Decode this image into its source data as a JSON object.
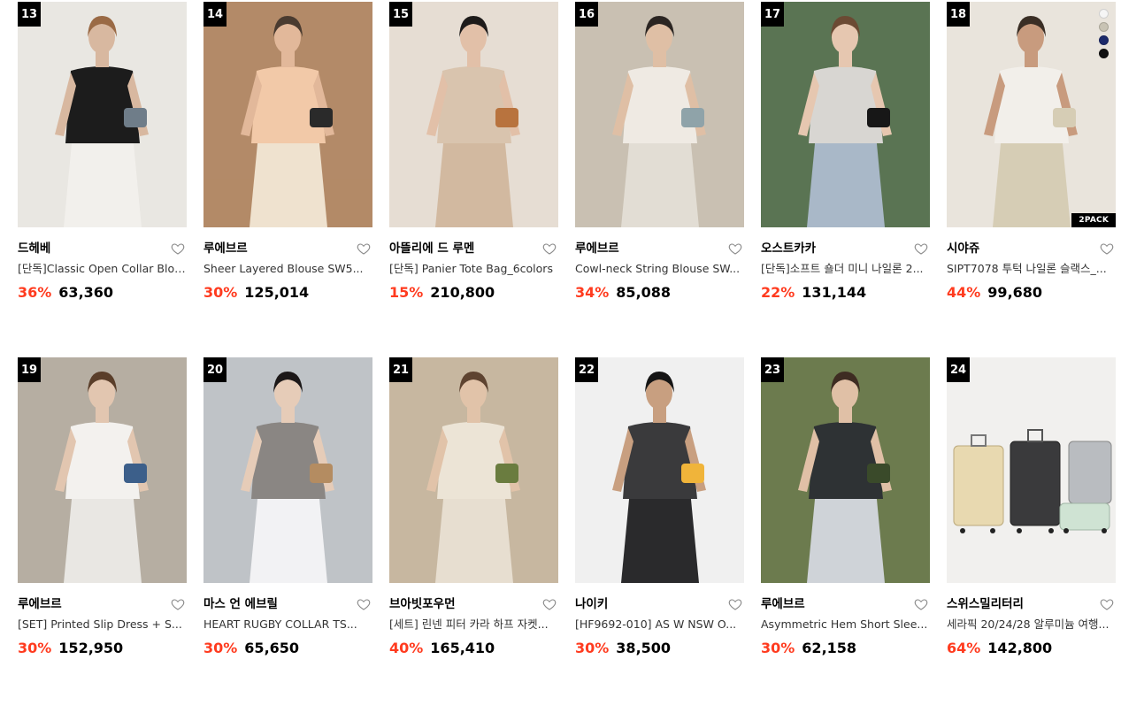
{
  "products": [
    {
      "rank": "13",
      "brand": "드헤베",
      "name": "[단독]Classic Open Collar Blouse",
      "discount": "36%",
      "price": "63,360",
      "colors": {
        "bg": "#e9e7e2",
        "top": "#1c1c1c",
        "bottom": "#f2f0ec",
        "skin": "#d8b8a0",
        "hair": "#9a6a45",
        "accent": "#6f7d89"
      }
    },
    {
      "rank": "14",
      "brand": "루에브르",
      "name": "Sheer Layered Blouse SW5...",
      "discount": "30%",
      "price": "125,014",
      "colors": {
        "bg": "#b38a68",
        "top": "#f2c9a8",
        "bottom": "#efe2cf",
        "skin": "#e2b89a",
        "hair": "#4a3b30",
        "accent": "#2a2a2a"
      }
    },
    {
      "rank": "15",
      "brand": "아뜰리에 드 루멘",
      "name": "[단독] Panier Tote Bag_6colors",
      "discount": "15%",
      "price": "210,800",
      "colors": {
        "bg": "#e6ddd3",
        "top": "#d9c4ae",
        "bottom": "#d2b9a0",
        "skin": "#e2c0a8",
        "hair": "#1e1b1a",
        "accent": "#b8733e"
      }
    },
    {
      "rank": "16",
      "brand": "루에브르",
      "name": "Cowl-neck String Blouse SW...",
      "discount": "34%",
      "price": "85,088",
      "colors": {
        "bg": "#c9c0b2",
        "top": "#efeae3",
        "bottom": "#e2ddd4",
        "skin": "#dfbfa5",
        "hair": "#2b2522",
        "accent": "#8fa3a9"
      }
    },
    {
      "rank": "17",
      "brand": "오스트카카",
      "name": "[단독]소프트 숄더 미니 나일론 2...",
      "discount": "22%",
      "price": "131,144",
      "colors": {
        "bg": "#5a7453",
        "top": "#d8d6d2",
        "bottom": "#a9b8c8",
        "skin": "#e6c7b0",
        "hair": "#6b4a33",
        "accent": "#171717"
      }
    },
    {
      "rank": "18",
      "brand": "시야쥬",
      "name": "SIPT7078 투턱 나일론 슬랙스_...",
      "discount": "44%",
      "price": "99,680",
      "colors": {
        "bg": "#e9e4dc",
        "top": "#f2efea",
        "bottom": "#d6cdb5",
        "skin": "#c89b7e",
        "hair": "#3a2e25",
        "accent": "#d6cdb5"
      },
      "swatches": [
        "#f5f5f5",
        "#c8c3b4",
        "#1c2a6b",
        "#111111"
      ],
      "badge": "2PACK"
    },
    {
      "rank": "19",
      "brand": "루에브르",
      "name": "[SET] Printed Slip Dress + S...",
      "discount": "30%",
      "price": "152,950",
      "colors": {
        "bg": "#b6aea2",
        "top": "#f3f1ee",
        "bottom": "#e9e7e3",
        "skin": "#e2c6b0",
        "hair": "#5a3e2a",
        "accent": "#3c5f8a"
      }
    },
    {
      "rank": "20",
      "brand": "마스 언 에브릴",
      "name": "HEART RUGBY COLLAR TS...",
      "discount": "30%",
      "price": "65,650",
      "colors": {
        "bg": "#bfc3c7",
        "top": "#8a8683",
        "bottom": "#f2f2f4",
        "skin": "#e6ccb8",
        "hair": "#1c1818",
        "accent": "#b48c61"
      }
    },
    {
      "rank": "21",
      "brand": "브아빗포우먼",
      "name": "[세트] 린넨 피터 카라 하프 자켓...",
      "discount": "40%",
      "price": "165,410",
      "colors": {
        "bg": "#c7b7a0",
        "top": "#ece4d6",
        "bottom": "#e7ded0",
        "skin": "#e1c3a9",
        "hair": "#5e4330",
        "accent": "#6a7c3f"
      }
    },
    {
      "rank": "22",
      "brand": "나이키",
      "name": "[HF9692-010] AS W NSW O...",
      "discount": "30%",
      "price": "38,500",
      "colors": {
        "bg": "#f0f0f0",
        "top": "#3a3a3c",
        "bottom": "#2a2a2c",
        "skin": "#c89f80",
        "hair": "#151515",
        "accent": "#f0b43a"
      }
    },
    {
      "rank": "23",
      "brand": "루에브르",
      "name": "Asymmetric Hem Short Slee...",
      "discount": "30%",
      "price": "62,158",
      "colors": {
        "bg": "#6c7b4e",
        "top": "#2e3234",
        "bottom": "#cfd3d8",
        "skin": "#e0c0a6",
        "hair": "#3e2c22",
        "accent": "#3a4a2a"
      }
    },
    {
      "rank": "24",
      "brand": "스위스밀리터리",
      "name": "세라픽 20/24/28 알루미늄 여행...",
      "discount": "64%",
      "price": "142,800",
      "colors": {
        "bg": "#f1f0ee",
        "top": "#e8d9b0",
        "bottom": "#3a3a3c",
        "skin": "#b9bcc0",
        "hair": "#cfe3d3",
        "accent": "#888888"
      },
      "luggage": true
    }
  ]
}
